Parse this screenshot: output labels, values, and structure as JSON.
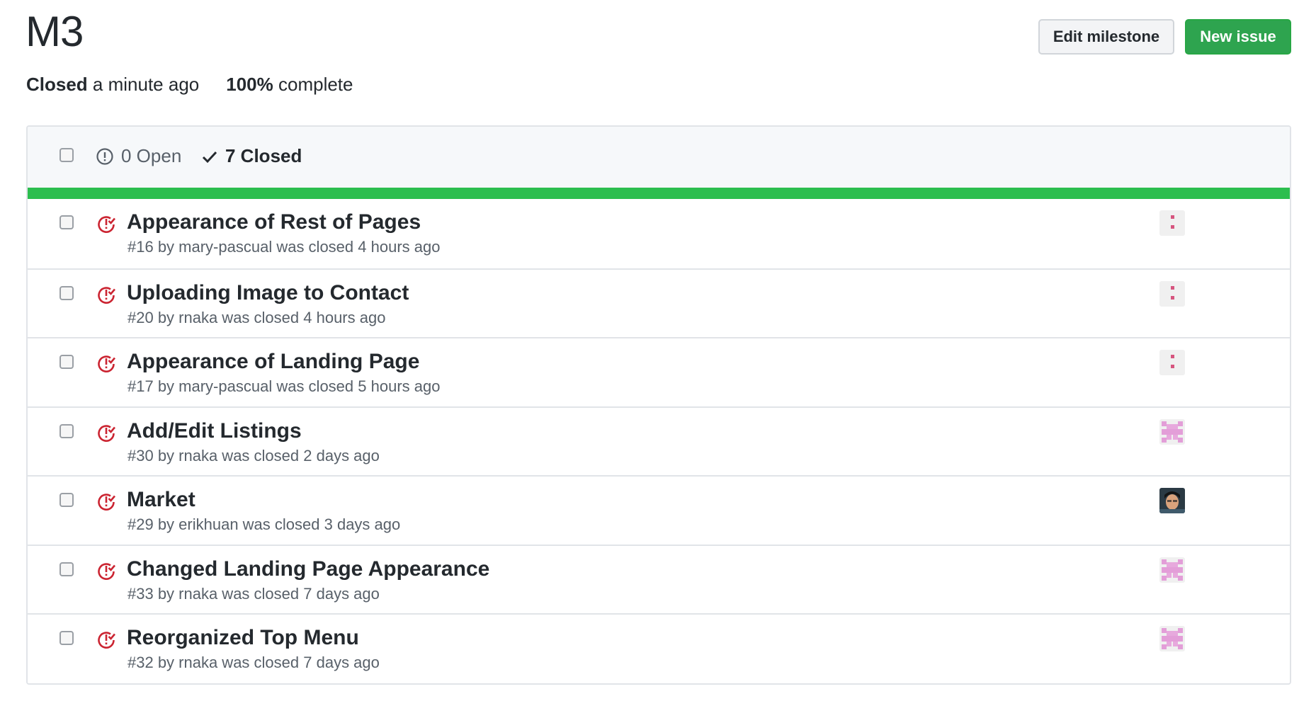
{
  "milestone": {
    "title": "M3",
    "status_label": "Closed",
    "status_time": "a minute ago",
    "progress_label": "100%",
    "progress_suffix": "complete",
    "progress_fraction": 1.0
  },
  "actions": {
    "edit_label": "Edit milestone",
    "new_label": "New issue"
  },
  "filter": {
    "open_label": "0 Open",
    "closed_label": "7 Closed"
  },
  "colors": {
    "closed_icon": "#cb2431",
    "progress": "#2cbe4e",
    "primary_button": "#2ea44f"
  },
  "issues": [
    {
      "title": "Appearance of Rest of Pages",
      "meta": "#16 by mary-pascual was closed 4 hours ago",
      "avatar": "identicon-dots"
    },
    {
      "title": "Uploading Image to Contact",
      "meta": "#20 by rnaka was closed 4 hours ago",
      "avatar": "identicon-dots"
    },
    {
      "title": "Appearance of Landing Page",
      "meta": "#17 by mary-pascual was closed 5 hours ago",
      "avatar": "identicon-dots"
    },
    {
      "title": "Add/Edit Listings",
      "meta": "#30 by rnaka was closed 2 days ago",
      "avatar": "identicon-pink"
    },
    {
      "title": "Market",
      "meta": "#29 by erikhuan was closed 3 days ago",
      "avatar": "photo"
    },
    {
      "title": "Changed Landing Page Appearance",
      "meta": "#33 by rnaka was closed 7 days ago",
      "avatar": "identicon-pink"
    },
    {
      "title": "Reorganized Top Menu",
      "meta": "#32 by rnaka was closed 7 days ago",
      "avatar": "identicon-pink"
    }
  ]
}
